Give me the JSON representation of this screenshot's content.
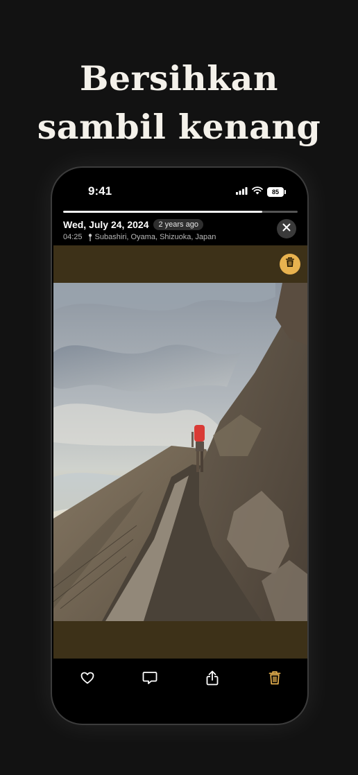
{
  "headline": {
    "line1": "Bersihkan",
    "line2": "sambil kenang"
  },
  "status_bar": {
    "time": "9:41",
    "battery": "85"
  },
  "story": {
    "progress": 0.85
  },
  "photo_info": {
    "date": "Wed, July 24, 2024",
    "relative_age": "2 years ago",
    "time": "04:25",
    "location": "Subashiri, Oyama, Shizuoka, Japan"
  },
  "icons": {
    "close": "close-icon",
    "delete_float": "trash-icon",
    "like": "heart-icon",
    "comment": "comment-icon",
    "share": "share-icon",
    "delete": "trash-icon",
    "location": "pin-icon"
  },
  "colors": {
    "background": "#121212",
    "accent": "#e8b24f",
    "photo_backdrop": "#3d3118",
    "headline": "#f4f1ea"
  }
}
